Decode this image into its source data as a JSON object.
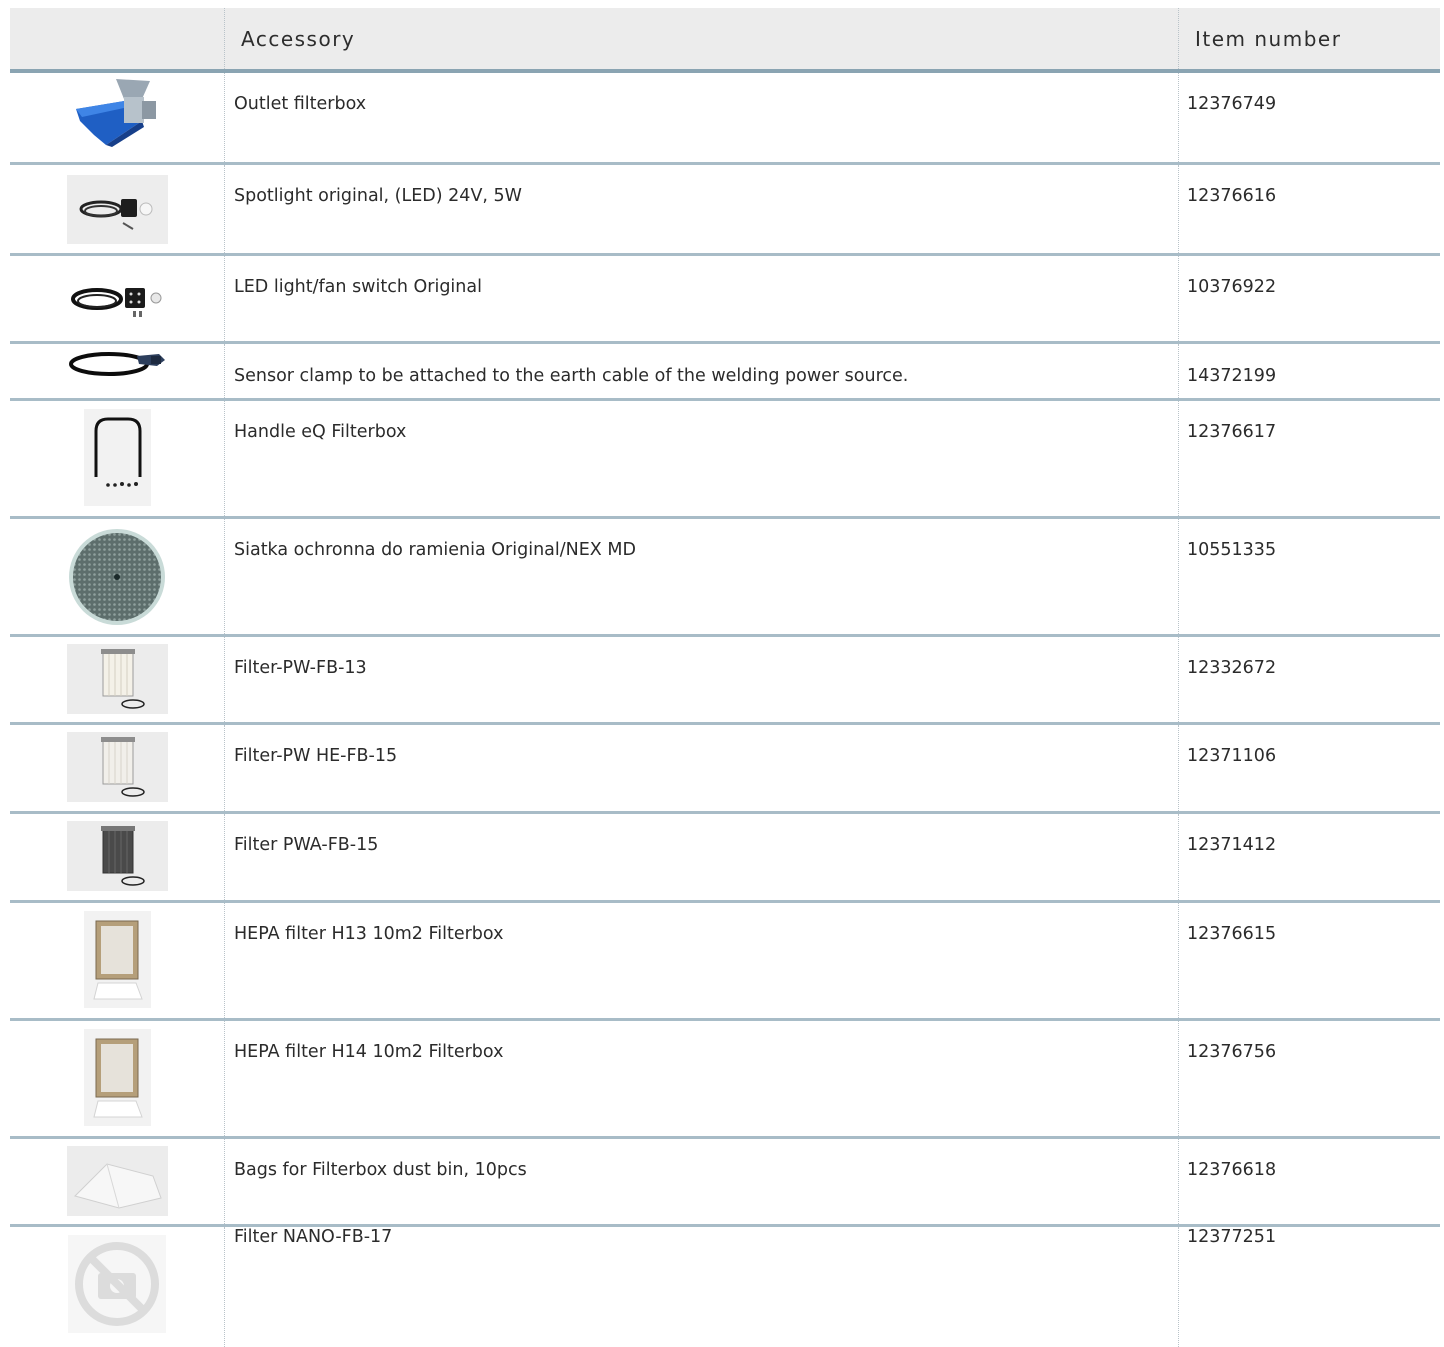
{
  "header": {
    "image_col": "",
    "accessory": "Accessory",
    "item_number": "Item number"
  },
  "rows": [
    {
      "name": "Outlet filterbox",
      "number": "12376749",
      "icon": "outlet-filterbox-icon"
    },
    {
      "name": "Spotlight original, (LED) 24V, 5W",
      "number": "12376616",
      "icon": "spotlight-icon"
    },
    {
      "name": "LED light/fan switch Original",
      "number": "10376922",
      "icon": "led-switch-icon"
    },
    {
      "name": "Sensor clamp to be attached to the earth cable of the welding power source.",
      "number": "14372199",
      "icon": "sensor-clamp-icon"
    },
    {
      "name": "Handle eQ Filterbox",
      "number": "12376617",
      "icon": "handle-icon"
    },
    {
      "name": "Siatka ochronna do ramienia Original/NEX MD",
      "number": "10551335",
      "icon": "protective-mesh-icon"
    },
    {
      "name": "Filter-PW-FB-13",
      "number": "12332672",
      "icon": "filter-cartridge-icon"
    },
    {
      "name": "Filter-PW HE-FB-15",
      "number": "12371106",
      "icon": "filter-cartridge-icon"
    },
    {
      "name": "Filter PWA-FB-15",
      "number": "12371412",
      "icon": "filter-cartridge-dark-icon"
    },
    {
      "name": "HEPA filter H13 10m2 Filterbox",
      "number": "12376615",
      "icon": "hepa-filter-icon"
    },
    {
      "name": "HEPA filter H14 10m2 Filterbox",
      "number": "12376756",
      "icon": "hepa-filter-icon"
    },
    {
      "name": "Bags for Filterbox dust bin, 10pcs",
      "number": "12376618",
      "icon": "dust-bags-icon"
    },
    {
      "name": "Filter NANO-FB-17",
      "number": "12377251",
      "icon": "no-image-icon"
    }
  ]
}
